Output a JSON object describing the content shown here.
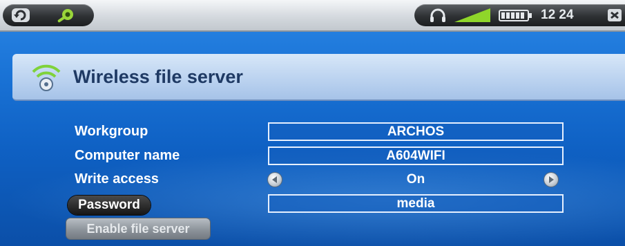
{
  "status_bar": {
    "time": "12 24",
    "icons": [
      "back-icon",
      "settings-icon",
      "headphones-icon",
      "volume-icon",
      "battery-icon",
      "close-icon"
    ]
  },
  "title": {
    "text": "Wireless file server",
    "icon": "wifi-server-icon"
  },
  "form": {
    "workgroup_label": "Workgroup",
    "workgroup_value": "ARCHOS",
    "computer_name_label": "Computer name",
    "computer_name_value": "A604WIFI",
    "write_access_label": "Write access",
    "write_access_value": "On",
    "password_label": "Password",
    "password_value": "media"
  },
  "actions": {
    "enable_label": "Enable file server"
  },
  "colors": {
    "background": "#1a73d6",
    "title_band": "#b9d1ef",
    "title_text": "#1f3a64",
    "accent_green": "#8fd62a"
  }
}
